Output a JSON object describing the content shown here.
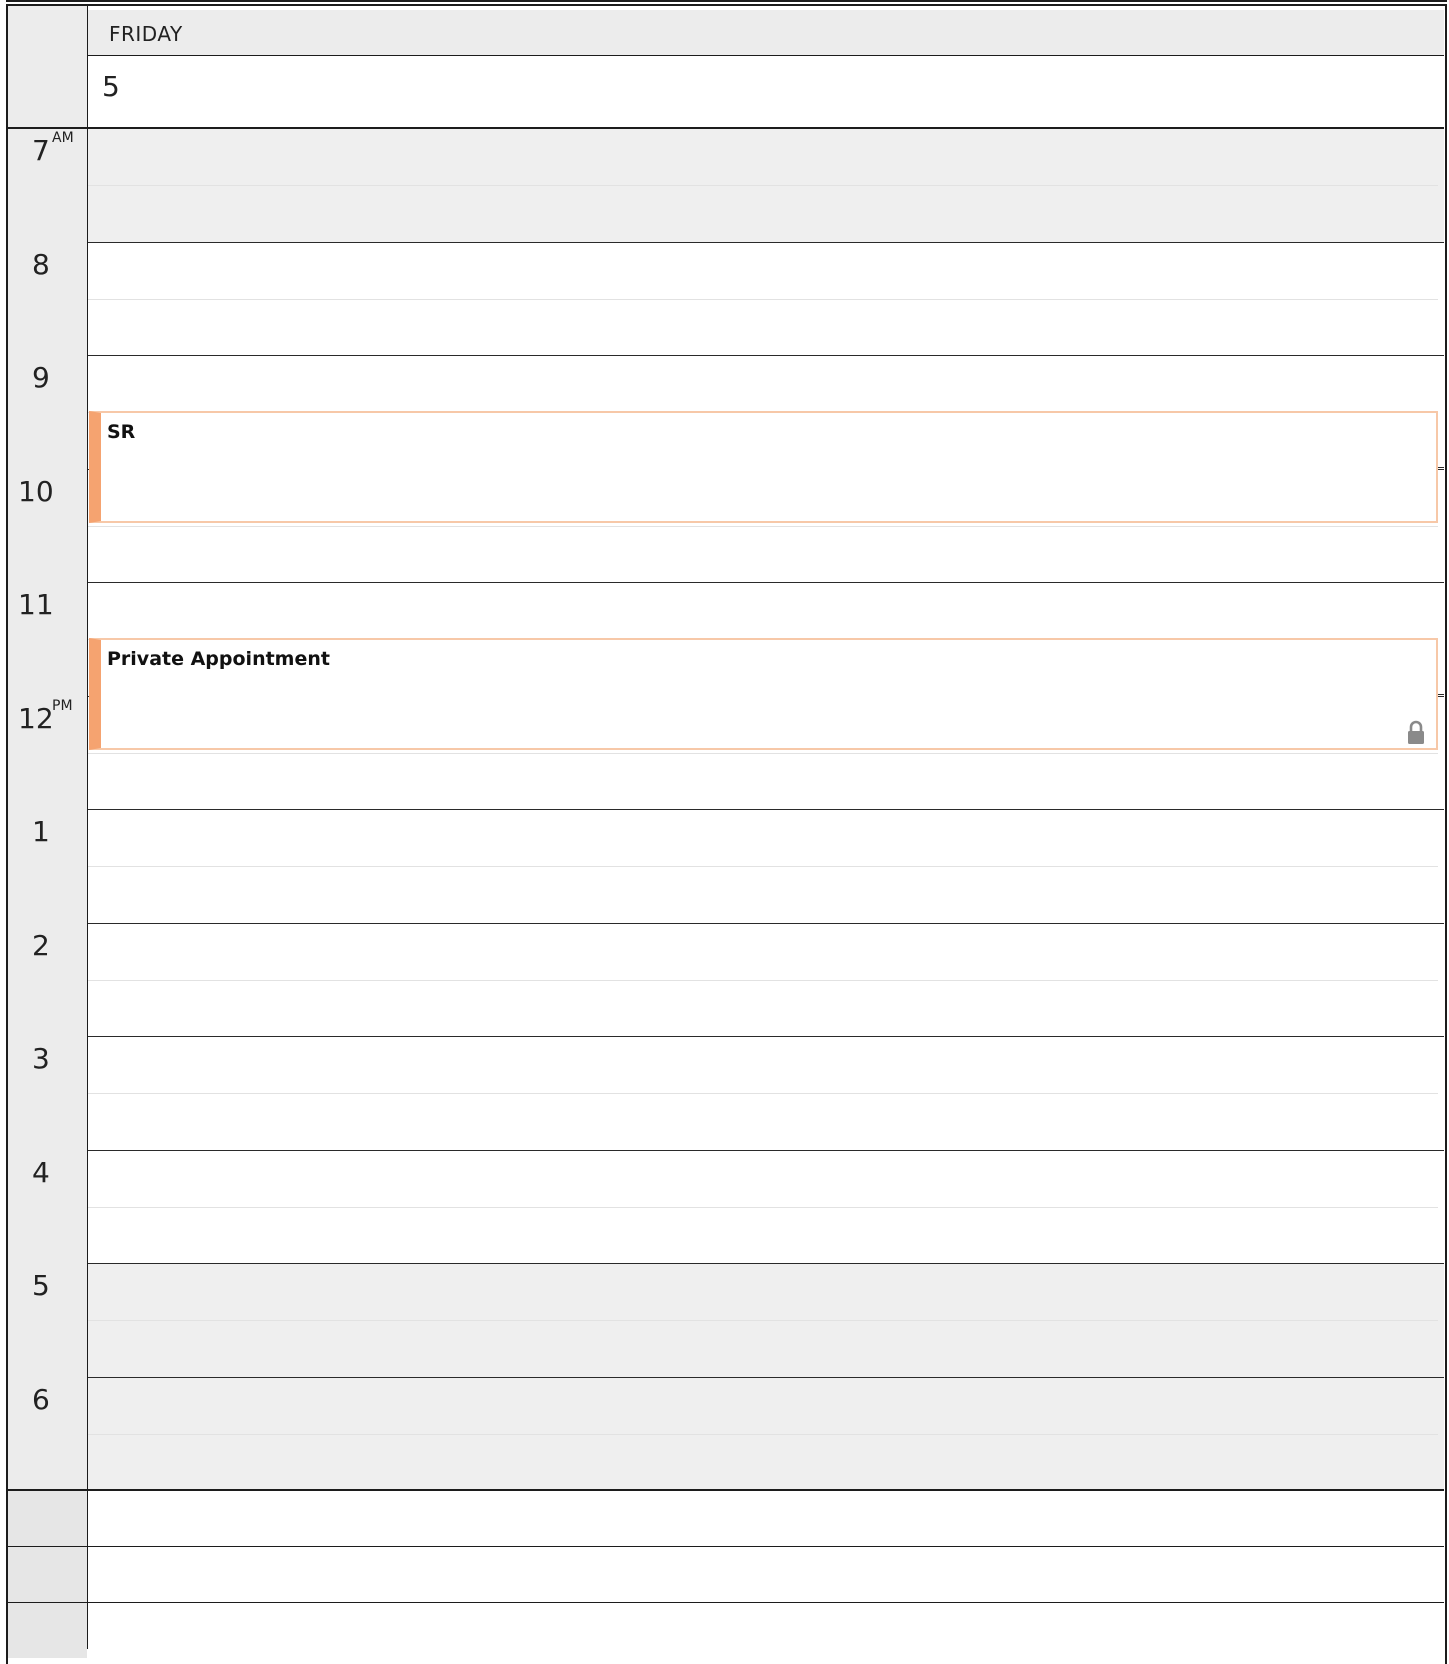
{
  "header": {
    "day_name": "FRIDAY",
    "date_number": "5"
  },
  "hours": [
    {
      "label": "7",
      "suffix": "AM"
    },
    {
      "label": "8",
      "suffix": ""
    },
    {
      "label": "9",
      "suffix": ""
    },
    {
      "label": "10",
      "suffix": ""
    },
    {
      "label": "11",
      "suffix": ""
    },
    {
      "label": "12",
      "suffix": "PM"
    },
    {
      "label": "1",
      "suffix": ""
    },
    {
      "label": "2",
      "suffix": ""
    },
    {
      "label": "3",
      "suffix": ""
    },
    {
      "label": "4",
      "suffix": ""
    },
    {
      "label": "5",
      "suffix": ""
    },
    {
      "label": "6",
      "suffix": ""
    }
  ],
  "events": [
    {
      "title": "SR",
      "private": false
    },
    {
      "title": "Private Appointment",
      "private": true
    }
  ],
  "colors": {
    "event_accent": "#f5a370",
    "event_border": "#f7c8a8",
    "off_hours_bg": "#efefef",
    "gutter_bg": "#ececec"
  },
  "icons": {
    "private_event": "lock-icon"
  }
}
